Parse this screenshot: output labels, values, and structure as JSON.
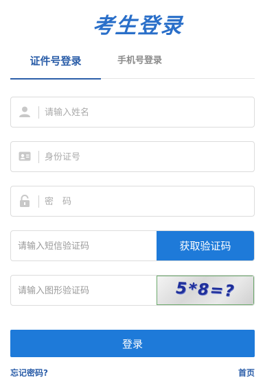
{
  "header": {
    "title": "考生登录"
  },
  "tabs": [
    {
      "label": "证件号登录",
      "active": true
    },
    {
      "label": "手机号登录",
      "active": false
    }
  ],
  "form": {
    "name": {
      "placeholder": "请输入姓名",
      "icon": "user-icon"
    },
    "id_number": {
      "placeholder": "身份证号",
      "icon": "id-card-icon"
    },
    "password": {
      "placeholder": "密　码",
      "icon": "lock-icon"
    },
    "sms": {
      "placeholder": "请输入短信验证码",
      "button_label": "获取验证码"
    },
    "captcha": {
      "placeholder": "请输入图形验证码",
      "image_text": "5*8=?"
    }
  },
  "actions": {
    "login_label": "登录",
    "forgot_label": "忘记密码?",
    "home_label": "首页"
  },
  "colors": {
    "accent": "#1e7ad9",
    "title": "#2a6fc9",
    "link": "#2a5da8"
  }
}
